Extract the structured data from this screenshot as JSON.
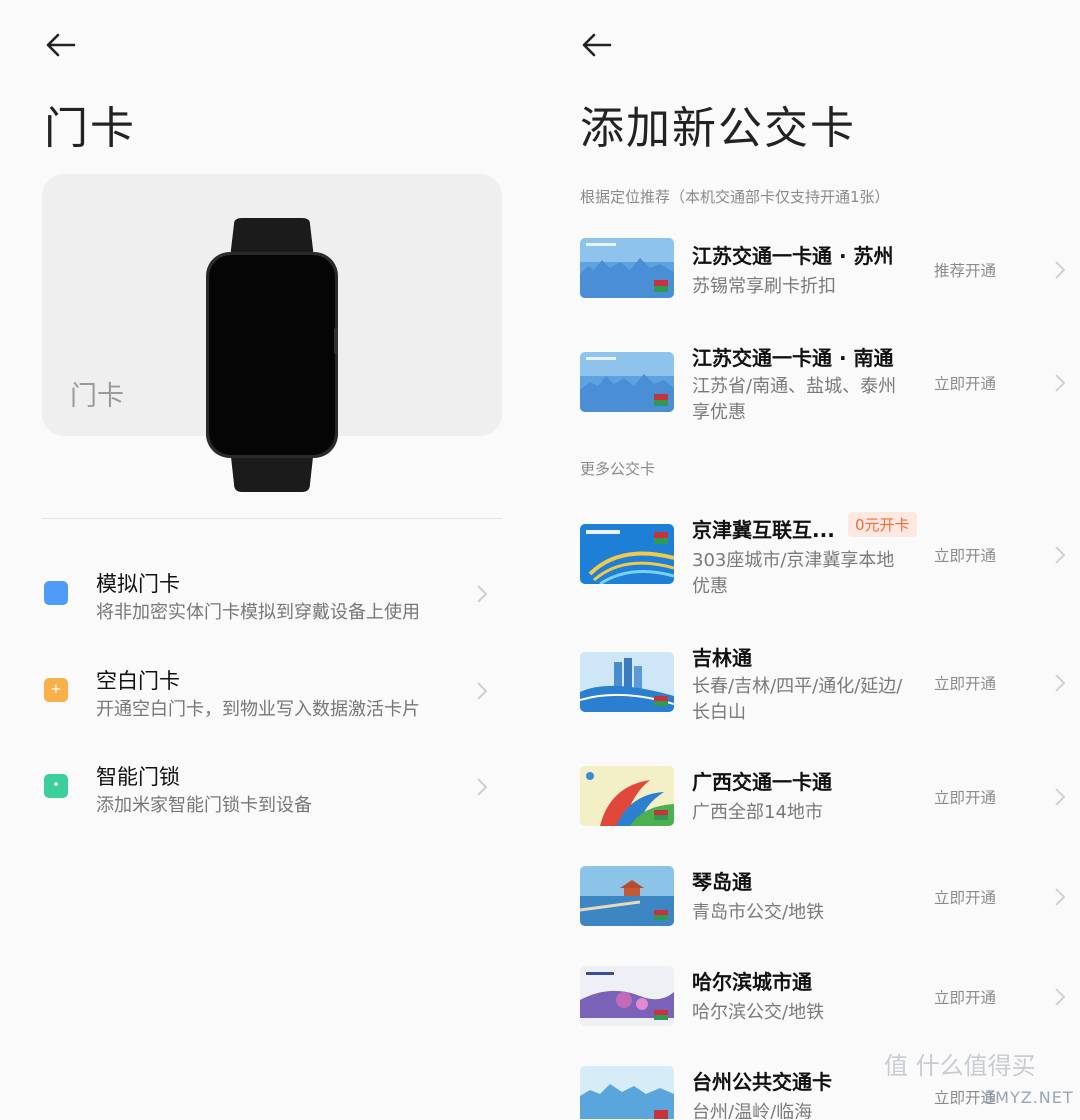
{
  "left": {
    "title": "门卡",
    "hero_label": "门卡",
    "options": [
      {
        "title": "模拟门卡",
        "subtitle": "将非加密实体门卡模拟到穿戴设备上使用",
        "icon": "card-icon",
        "color": "#4f9cf8"
      },
      {
        "title": "空白门卡",
        "subtitle": "开通空白门卡，到物业写入数据激活卡片",
        "icon": "plus-icon",
        "color": "#f7b04a"
      },
      {
        "title": "智能门锁",
        "subtitle": "添加米家智能门锁卡到设备",
        "icon": "drop-icon",
        "color": "#3ccf9b"
      }
    ]
  },
  "right": {
    "title": "添加新公交卡",
    "section_recommended": "根据定位推荐（本机交通部卡仅支持开通1张）",
    "section_more": "更多公交卡",
    "recommended": [
      {
        "name": "江苏交通一卡通 · 苏州",
        "desc": "苏锡常享刷卡折扣",
        "action": "推荐开通"
      },
      {
        "name": "江苏交通一卡通 · 南通",
        "desc": "江苏省/南通、盐城、泰州享优惠",
        "action": "立即开通"
      }
    ],
    "more": [
      {
        "name": "京津冀互联互...",
        "badge": "0元开卡",
        "desc": "303座城市/京津冀享本地优惠",
        "action": "立即开通"
      },
      {
        "name": "吉林通",
        "desc": "长春/吉林/四平/通化/延边/长白山",
        "action": "立即开通"
      },
      {
        "name": "广西交通一卡通",
        "desc": "广西全部14地市",
        "action": "立即开通"
      },
      {
        "name": "琴岛通",
        "desc": "青岛市公交/地铁",
        "action": "立即开通"
      },
      {
        "name": "哈尔滨城市通",
        "desc": "哈尔滨公交/地铁",
        "action": "立即开通"
      },
      {
        "name": "台州公共交通卡",
        "desc": "台州/温岭/临海",
        "action": "立即开通"
      }
    ]
  },
  "watermark": {
    "text": "SMYZ.NET",
    "logo": "值 什么值得买"
  }
}
